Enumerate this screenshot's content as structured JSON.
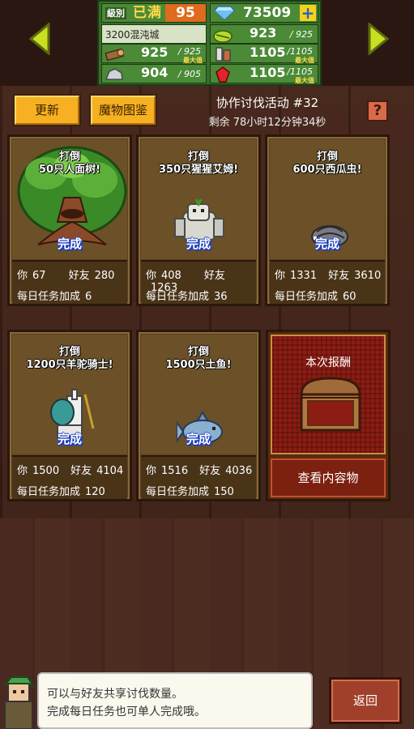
{
  "header": {
    "level_tag": "級別",
    "level_name": "已满",
    "level_num": "95",
    "gems": "73509",
    "town": "3200混沌城",
    "resources": [
      {
        "icon": "wood-icon",
        "value": "925",
        "max": "/ 925",
        "label": "最大值"
      },
      {
        "icon": "grass-icon",
        "value": "923",
        "max": "/ 925",
        "label": ""
      },
      {
        "icon": "stone-icon",
        "value": "904",
        "max": "/ 905",
        "label": ""
      },
      {
        "icon": "gear-icon",
        "value": "1105",
        "max": "/1105",
        "label": "最大值"
      },
      {
        "icon": "ore-icon",
        "value": "1105",
        "max": "/1105",
        "label": "最大值"
      },
      {
        "icon": "ruby-icon",
        "value": "1105",
        "max": "/1105",
        "label": "最大值"
      }
    ]
  },
  "toolbar": {
    "refresh_label": "更新",
    "monster_book_label": "魔物图鉴",
    "event_title": "协作讨伐活动 #32",
    "remaining": "剩余 78小时12分钟34秒",
    "help": "?"
  },
  "labels": {
    "you": "你",
    "friends": "好友",
    "daily_bonus": "每日任务加成",
    "complete": "完成"
  },
  "quests": [
    {
      "line1": "打倒",
      "line2": "50只人面树!",
      "you": "67",
      "friends": "280",
      "bonus": "6",
      "monster": "tree-monster-icon"
    },
    {
      "line1": "打倒",
      "line2": "350只猩猩艾姆!",
      "you": "408",
      "friends": "1263",
      "bonus": "36",
      "monster": "gorilla-monster-icon"
    },
    {
      "line1": "打倒",
      "line2": "600只西瓜虫!",
      "you": "1331",
      "friends": "3610",
      "bonus": "60",
      "monster": "pillbug-monster-icon"
    },
    {
      "line1": "打倒",
      "line2": "1200只羊驼骑士!",
      "you": "1500",
      "friends": "4104",
      "bonus": "120",
      "monster": "alpaca-knight-icon"
    },
    {
      "line1": "打倒",
      "line2": "1500只土鱼!",
      "you": "1516",
      "friends": "4036",
      "bonus": "150",
      "monster": "mudfish-monster-icon"
    }
  ],
  "reward": {
    "title": "本次报酬",
    "button": "查看内容物"
  },
  "dialog": {
    "line1": "可以与好友共享讨伐数量。",
    "line2": "完成每日任务也可单人完成哦。"
  },
  "back_label": "返回"
}
